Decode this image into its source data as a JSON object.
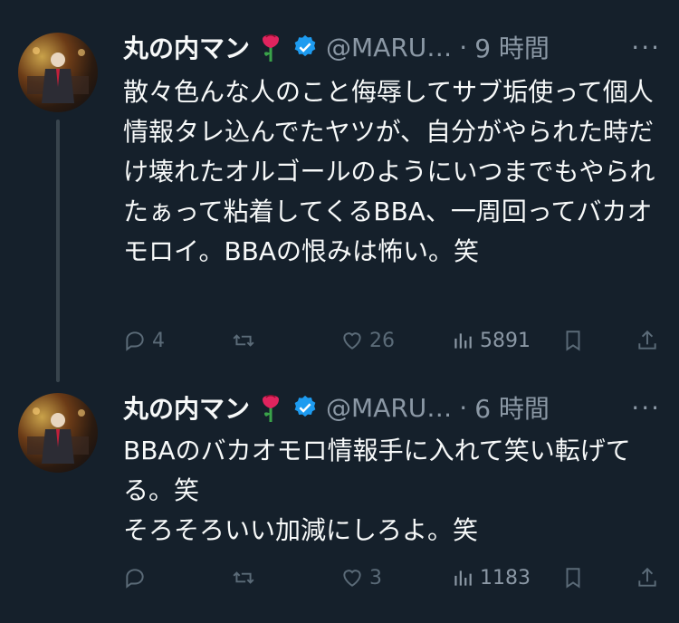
{
  "tweets": [
    {
      "name": "丸の内マン",
      "handle": "@MARU…",
      "dot": "·",
      "time": "9 時間",
      "text": "散々色んな人のこと侮辱してサブ垢使って個人情報タレ込んでたヤツが、自分がやられた時だけ壊れたオルゴールのようにいつまでもやられたぁって粘着してくるBBA、一周回ってバカオモロイ。BBAの恨みは怖い。笑",
      "replies": "4",
      "retweets": "",
      "likes": "26",
      "views": "5891"
    },
    {
      "name": "丸の内マン",
      "handle": "@MARU…",
      "dot": "·",
      "time": "6 時間",
      "text": "BBAのバカオモロ情報手に入れて笑い転げてる。笑\nそろそろいい加減にしろよ。笑",
      "replies": "",
      "retweets": "",
      "likes": "3",
      "views": "1183"
    }
  ],
  "colors": {
    "background": "#15202b",
    "text": "#f7f9f9",
    "secondary": "#8b98a5",
    "verified": "#1d9bf0",
    "rose": "#e0245e"
  },
  "icons": [
    "rose-emoji",
    "verified-badge",
    "more-icon",
    "reply-icon",
    "retweet-icon",
    "like-icon",
    "views-icon",
    "bookmark-icon",
    "share-icon"
  ]
}
